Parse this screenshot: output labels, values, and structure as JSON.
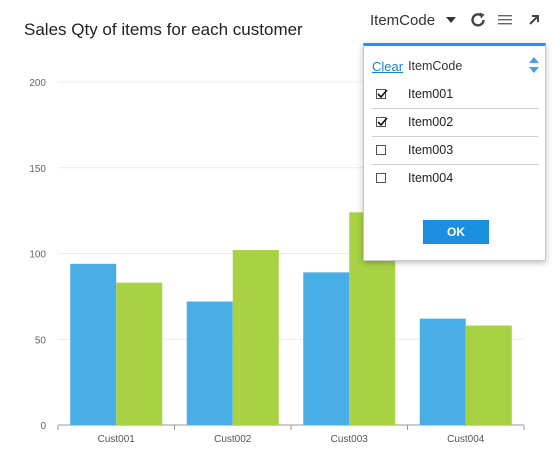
{
  "chart_title": "Sales Qty of items for each customer",
  "toolbar": {
    "filter_label": "ItemCode",
    "icons": [
      "chevron-down-icon",
      "refresh-icon",
      "list-icon",
      "expand-icon"
    ]
  },
  "filter_popup": {
    "clear_label": "Clear",
    "column_label": "ItemCode",
    "items": [
      {
        "label": "Item001",
        "checked": true
      },
      {
        "label": "Item002",
        "checked": true
      },
      {
        "label": "Item003",
        "checked": false
      },
      {
        "label": "Item004",
        "checked": false
      }
    ],
    "ok_label": "OK",
    "accent_color": "#1e90ff"
  },
  "chart_data": {
    "type": "bar",
    "title": "Sales Qty of items for each customer",
    "categories": [
      "Cust001",
      "Cust002",
      "Cust003",
      "Cust004"
    ],
    "series": [
      {
        "values": [
          94,
          72,
          89,
          62
        ],
        "color": "#4aaee6"
      },
      {
        "values": [
          83,
          102,
          124,
          58
        ],
        "color": "#a8d144"
      }
    ],
    "yticks": [
      0,
      50,
      100,
      150,
      200
    ],
    "ylim": [
      0,
      210
    ],
    "xlabel": "",
    "ylabel": "",
    "grid": true,
    "legend": "none"
  }
}
